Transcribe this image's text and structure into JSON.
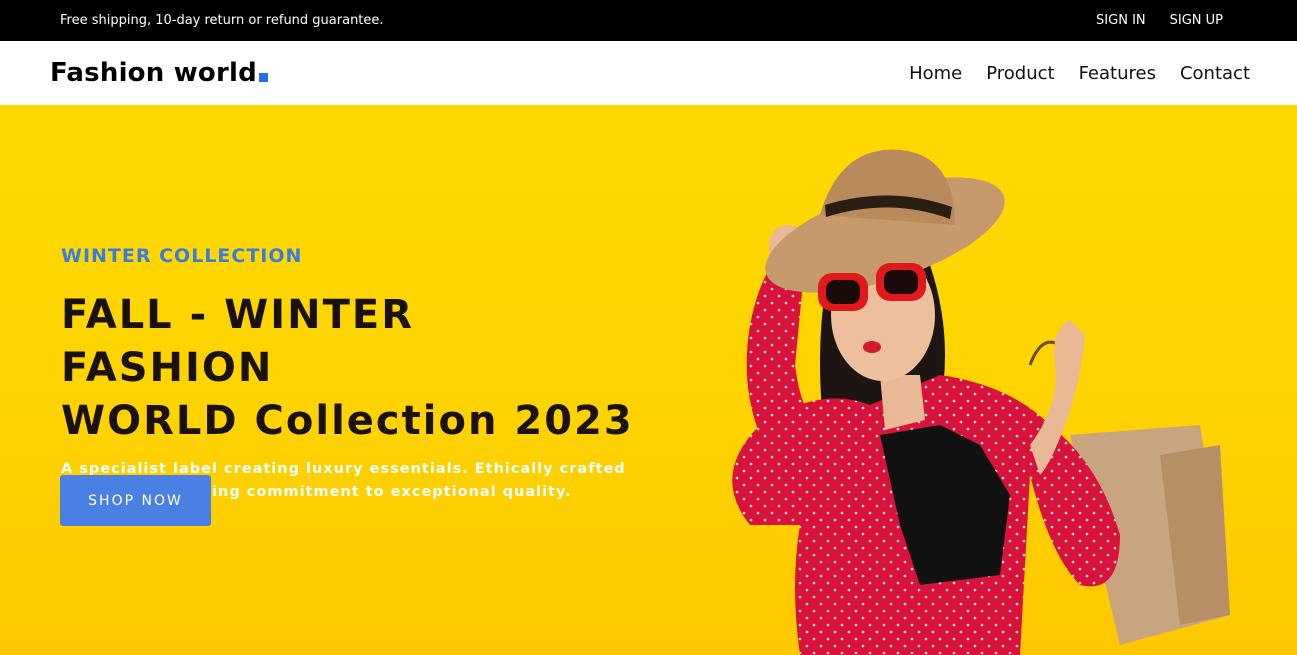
{
  "topbar": {
    "promo": "Free shipping, 10-day return or refund guarantee.",
    "sign_in": "SIGN IN",
    "sign_up": "SIGN UP"
  },
  "header": {
    "logo": "Fashion world",
    "nav": [
      "Home",
      "Product",
      "Features",
      "Contact"
    ]
  },
  "hero": {
    "eyebrow": "WINTER COLLECTION",
    "headline_line1": "FALL - WINTER FASHION",
    "headline_line2": "WORLD Collection 2023",
    "description": "A specialist label creating luxury essentials. Ethically crafted with an unwavering commitment to exceptional quality.",
    "cta": "SHOP NOW"
  },
  "colors": {
    "topbar_bg": "#000000",
    "hero_bg": "#ffd400",
    "accent_blue": "#4a7fe3",
    "logo_dot": "#1e6fe8"
  }
}
